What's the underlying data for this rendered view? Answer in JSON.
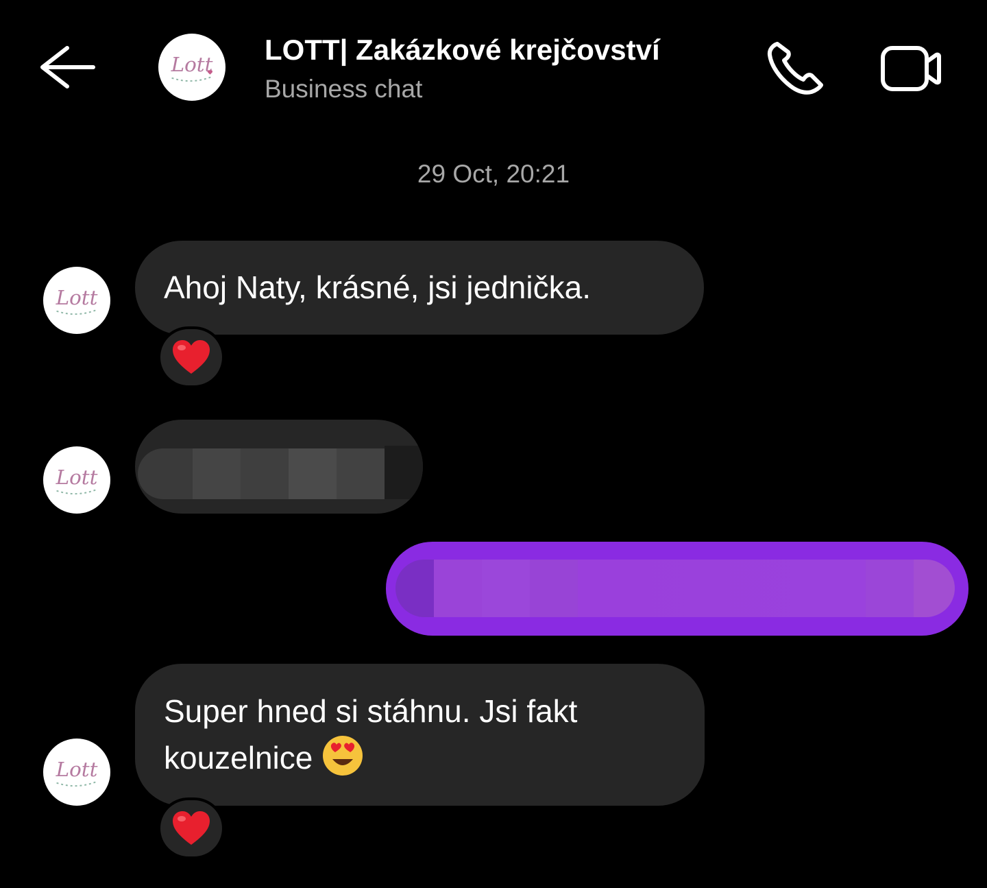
{
  "header": {
    "back_icon": "arrow-left-icon",
    "title": "LOTT| Zakázkové krejčovství",
    "subtitle": "Business chat",
    "call_icon": "phone-icon",
    "video_icon": "video-camera-icon",
    "avatar_logo_text": "Lott"
  },
  "timestamp": "29 Oct, 20:21",
  "messages": [
    {
      "from": "LOTT",
      "text": "Ahoj Naty, krásné, jsi jednička.",
      "reaction": "❤️"
    },
    {
      "from": "LOTT",
      "text": "",
      "redacted": true
    },
    {
      "from": "me",
      "text": "",
      "redacted": true
    },
    {
      "from": "LOTT",
      "text": "Super hned si stáhnu. Jsi fakt kouzelnice",
      "emoji": "😍",
      "reaction": "❤️"
    }
  ],
  "colors": {
    "background": "#000000",
    "incoming_bubble": "#262626",
    "outgoing_bubble": "#8a2be2",
    "secondary_text": "#a8a8a8",
    "heart": "#e8202e"
  }
}
